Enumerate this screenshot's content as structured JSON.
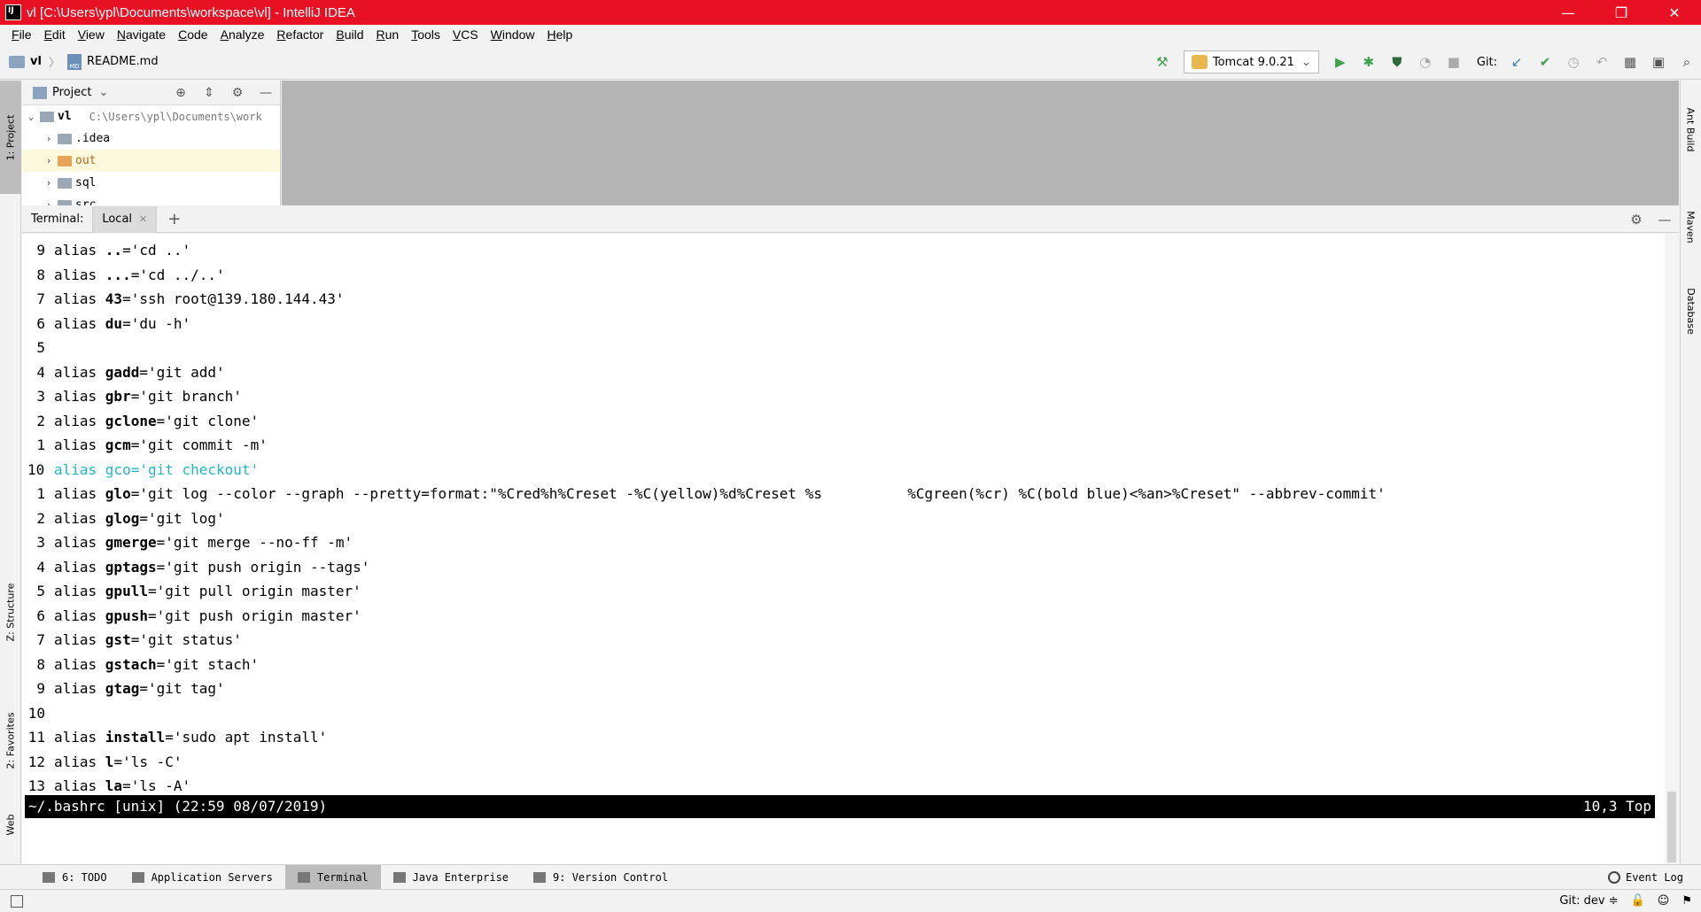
{
  "window": {
    "title": "vl [C:\\Users\\ypl\\Documents\\workspace\\vl] - IntelliJ IDEA",
    "minimize": "—",
    "restore": "❐",
    "close": "✕"
  },
  "menu": [
    "File",
    "Edit",
    "View",
    "Navigate",
    "Code",
    "Analyze",
    "Refactor",
    "Build",
    "Run",
    "Tools",
    "VCS",
    "Window",
    "Help"
  ],
  "breadcrumb": {
    "project": "vl",
    "file": "README.md",
    "file_icon_text": "MD"
  },
  "toolbar": {
    "run_config": "Tomcat 9.0.21",
    "git_label": "Git:"
  },
  "left_tabs": {
    "project": "1: Project",
    "structure": "Z: Structure",
    "favorites": "2: Favorites",
    "web": "Web"
  },
  "right_tabs": {
    "ant": "Ant Build",
    "maven": "Maven",
    "database": "Database"
  },
  "project_panel": {
    "title": "Project",
    "root": {
      "name": "vl",
      "path": "C:\\Users\\ypl\\Documents\\work"
    },
    "items": [
      {
        "name": ".idea"
      },
      {
        "name": "out"
      },
      {
        "name": "sql"
      },
      {
        "name": "src"
      }
    ]
  },
  "terminal": {
    "label": "Terminal:",
    "tab": "Local",
    "lines": [
      {
        "n": "9",
        "pre": "alias ",
        "kw": "..",
        "rest": "='cd ..'"
      },
      {
        "n": "8",
        "pre": "alias ",
        "kw": "...",
        "rest": "='cd ../..'"
      },
      {
        "n": "7",
        "pre": "alias ",
        "kw": "43",
        "rest": "='ssh root@139.180.144.43'"
      },
      {
        "n": "6",
        "pre": "alias ",
        "kw": "du",
        "rest": "='du -h'"
      },
      {
        "n": "5",
        "pre": "",
        "kw": "",
        "rest": ""
      },
      {
        "n": "4",
        "pre": "alias ",
        "kw": "gadd",
        "rest": "='git add'"
      },
      {
        "n": "3",
        "pre": "alias ",
        "kw": "gbr",
        "rest": "='git branch'"
      },
      {
        "n": "2",
        "pre": "alias ",
        "kw": "gclone",
        "rest": "='git clone'"
      },
      {
        "n": "1",
        "pre": "alias ",
        "kw": "gcm",
        "rest": "='git commit -m'"
      },
      {
        "n": "10",
        "pre": "alias ",
        "kw": "gco",
        "rest": "='git checkout'",
        "current": true
      },
      {
        "n": "1",
        "pre": "alias ",
        "kw": "glo",
        "rest": "='git log --color --graph --pretty=format:\"%Cred%h%Creset -%C(yellow)%d%Creset %s          %Cgreen(%cr) %C(bold blue)<%an>%Creset\" --abbrev-commit'"
      },
      {
        "n": "2",
        "pre": "alias ",
        "kw": "glog",
        "rest": "='git log'"
      },
      {
        "n": "3",
        "pre": "alias ",
        "kw": "gmerge",
        "rest": "='git merge --no-ff -m'"
      },
      {
        "n": "4",
        "pre": "alias ",
        "kw": "gptags",
        "rest": "='git push origin --tags'"
      },
      {
        "n": "5",
        "pre": "alias ",
        "kw": "gpull",
        "rest": "='git pull origin master'"
      },
      {
        "n": "6",
        "pre": "alias ",
        "kw": "gpush",
        "rest": "='git push origin master'"
      },
      {
        "n": "7",
        "pre": "alias ",
        "kw": "gst",
        "rest": "='git status'"
      },
      {
        "n": "8",
        "pre": "alias ",
        "kw": "gstach",
        "rest": "='git stach'"
      },
      {
        "n": "9",
        "pre": "alias ",
        "kw": "gtag",
        "rest": "='git tag'"
      },
      {
        "n": "10",
        "pre": "",
        "kw": "",
        "rest": ""
      },
      {
        "n": "11",
        "pre": "alias ",
        "kw": "install",
        "rest": "='sudo apt install'"
      },
      {
        "n": "12",
        "pre": "alias ",
        "kw": "l",
        "rest": "='ls -C'"
      },
      {
        "n": "13",
        "pre": "alias ",
        "kw": "la",
        "rest": "='ls -A'"
      }
    ],
    "status_left": "~/.bashrc [unix] (22:59 08/07/2019)",
    "status_right": "10,3 Top"
  },
  "bottom_tabs": [
    {
      "label": "6: TODO"
    },
    {
      "label": "Application Servers"
    },
    {
      "label": "Terminal",
      "active": true
    },
    {
      "label": "Java Enterprise"
    },
    {
      "label": "9: Version Control"
    }
  ],
  "event_log": "Event Log",
  "status": {
    "git": "Git: dev ≑"
  },
  "colors": {
    "titlebar": "#e81123",
    "cursor_line": "#22b5c5",
    "run_green": "#3fa34d"
  }
}
